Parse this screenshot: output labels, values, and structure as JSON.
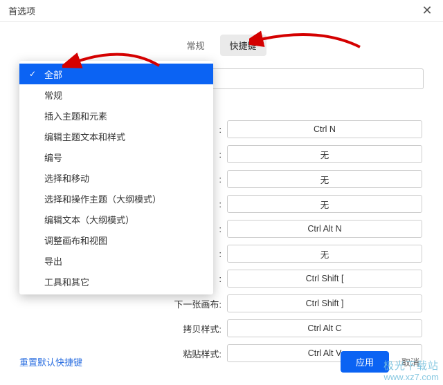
{
  "window": {
    "title": "首选项"
  },
  "tabs": {
    "items": [
      {
        "label": "常规",
        "active": false
      },
      {
        "label": "快捷键",
        "active": true
      }
    ]
  },
  "dropdown": {
    "selected_index": 0,
    "items": [
      "全部",
      "常规",
      "插入主题和元素",
      "编辑主题文本和样式",
      "编号",
      "选择和移动",
      "选择和操作主题（大纲模式）",
      "编辑文本（大纲模式）",
      "调整画布和视图",
      "导出",
      "工具和其它"
    ]
  },
  "shortcuts": [
    {
      "label": ":",
      "value": "Ctrl N"
    },
    {
      "label": ":",
      "value": "无"
    },
    {
      "label": ":",
      "value": "无"
    },
    {
      "label": ":",
      "value": "无"
    },
    {
      "label": ":",
      "value": "Ctrl Alt N"
    },
    {
      "label": ":",
      "value": "无"
    },
    {
      "label": ":",
      "value": "Ctrl Shift ["
    },
    {
      "label": "下一张画布:",
      "value": "Ctrl Shift ]"
    },
    {
      "label": "拷贝样式:",
      "value": "Ctrl Alt C"
    },
    {
      "label": "粘贴样式:",
      "value": "Ctrl Alt V"
    }
  ],
  "footer": {
    "reset": "重置默认快捷键",
    "apply": "应用",
    "cancel": "取消"
  },
  "watermark": {
    "line1": "极光下载站",
    "line2": "www.xz7.com"
  }
}
